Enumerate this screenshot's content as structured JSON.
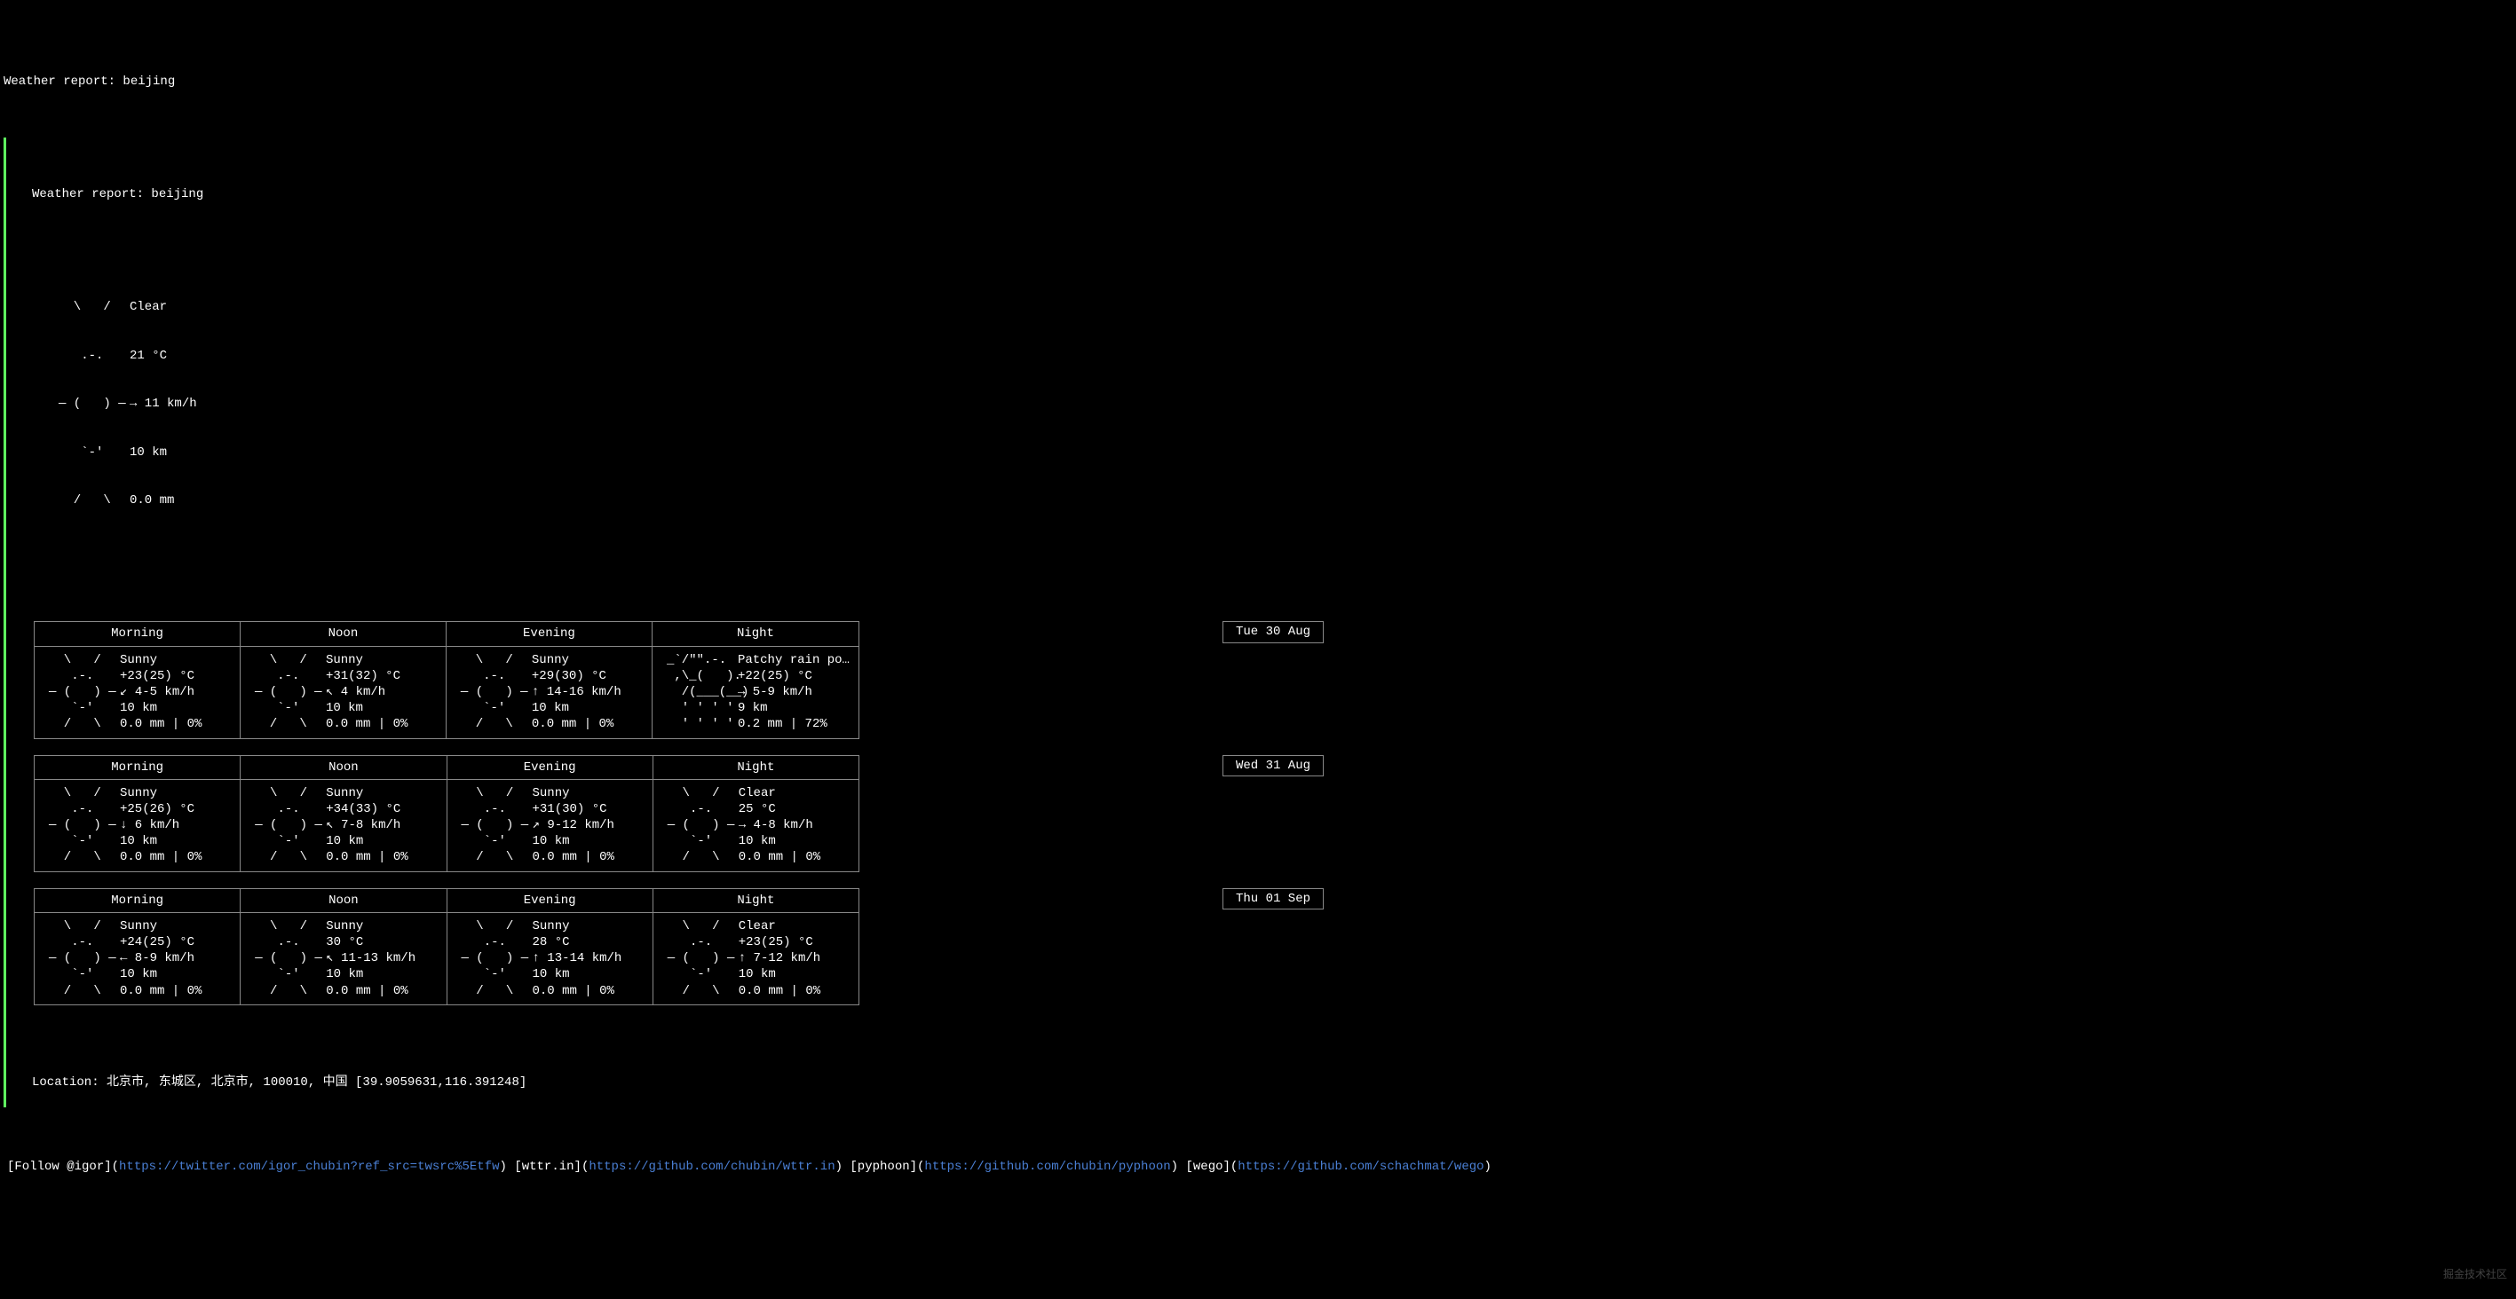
{
  "title_line": "Weather report: beijing",
  "header_line": "Weather report: beijing",
  "current": {
    "art": [
      "  \\   /  ",
      "   .-.   ",
      "― (   ) ―",
      "   `-'   ",
      "  /   \\  "
    ],
    "condition": "Clear",
    "temp": "21 °C",
    "wind": "→ 11 km/h",
    "visibility": "10 km",
    "precip": "0.0 mm"
  },
  "art": {
    "sunny": [
      "  \\   /  ",
      "   .-.   ",
      "― (   ) ―",
      "   `-'   ",
      "  /   \\  "
    ],
    "rain": [
      "_`/\"\".-. ",
      " ,\\_(   ).",
      "  /(___(__)",
      "  ' ' ' ' ",
      "  ' ' ' ' "
    ]
  },
  "period_labels": [
    "Morning",
    "Noon",
    "Evening",
    "Night"
  ],
  "days": [
    {
      "date": "Tue 30 Aug",
      "periods": [
        {
          "art": "sunny",
          "condition": "Sunny",
          "temp": "+23(25) °C",
          "wind": "↙ 4-5 km/h",
          "visibility": "10 km",
          "precip": "0.0 mm | 0%"
        },
        {
          "art": "sunny",
          "condition": "Sunny",
          "temp": "+31(32) °C",
          "wind": "↖ 4 km/h",
          "visibility": "10 km",
          "precip": "0.0 mm | 0%"
        },
        {
          "art": "sunny",
          "condition": "Sunny",
          "temp": "+29(30) °C",
          "wind": "↑ 14-16 km/h",
          "visibility": "10 km",
          "precip": "0.0 mm | 0%"
        },
        {
          "art": "rain",
          "condition": "Patchy rain po…",
          "temp": "+22(25) °C",
          "wind": "→ 5-9 km/h",
          "visibility": "9 km",
          "precip": "0.2 mm | 72%"
        }
      ]
    },
    {
      "date": "Wed 31 Aug",
      "periods": [
        {
          "art": "sunny",
          "condition": "Sunny",
          "temp": "+25(26) °C",
          "wind": "↓ 6 km/h",
          "visibility": "10 km",
          "precip": "0.0 mm | 0%"
        },
        {
          "art": "sunny",
          "condition": "Sunny",
          "temp": "+34(33) °C",
          "wind": "↖ 7-8 km/h",
          "visibility": "10 km",
          "precip": "0.0 mm | 0%"
        },
        {
          "art": "sunny",
          "condition": "Sunny",
          "temp": "+31(30) °C",
          "wind": "↗ 9-12 km/h",
          "visibility": "10 km",
          "precip": "0.0 mm | 0%"
        },
        {
          "art": "sunny",
          "condition": "Clear",
          "temp": "25 °C",
          "wind": "→ 4-8 km/h",
          "visibility": "10 km",
          "precip": "0.0 mm | 0%"
        }
      ]
    },
    {
      "date": "Thu 01 Sep",
      "periods": [
        {
          "art": "sunny",
          "condition": "Sunny",
          "temp": "+24(25) °C",
          "wind": "← 8-9 km/h",
          "visibility": "10 km",
          "precip": "0.0 mm | 0%"
        },
        {
          "art": "sunny",
          "condition": "Sunny",
          "temp": "30 °C",
          "wind": "↖ 11-13 km/h",
          "visibility": "10 km",
          "precip": "0.0 mm | 0%"
        },
        {
          "art": "sunny",
          "condition": "Sunny",
          "temp": "28 °C",
          "wind": "↑ 13-14 km/h",
          "visibility": "10 km",
          "precip": "0.0 mm | 0%"
        },
        {
          "art": "sunny",
          "condition": "Clear",
          "temp": "+23(25) °C",
          "wind": "↑ 7-12 km/h",
          "visibility": "10 km",
          "precip": "0.0 mm | 0%"
        }
      ]
    }
  ],
  "location": "Location: 北京市, 东城区, 北京市, 100010, 中国 [39.9059631,116.391248]",
  "footer": {
    "parts": [
      {
        "pre": "[Follow @igor](",
        "url": "https://twitter.com/igor_chubin?ref_src=twsrc%5Etfw",
        "post": ") "
      },
      {
        "pre": "[wttr.in](",
        "url": "https://github.com/chubin/wttr.in",
        "post": ") "
      },
      {
        "pre": "[pyphoon](",
        "url": "https://github.com/chubin/pyphoon",
        "post": ") "
      },
      {
        "pre": "[wego](",
        "url": "https://github.com/schachmat/wego",
        "post": ")"
      }
    ]
  },
  "watermark": "掘金技术社区"
}
